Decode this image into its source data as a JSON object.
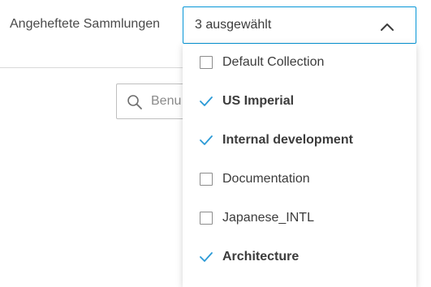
{
  "filter": {
    "label": "Angeheftete Sammlungen",
    "selected_text": "3 ausgewählt"
  },
  "search": {
    "placeholder": "Benu"
  },
  "options": [
    {
      "label": "Default Collection",
      "selected": false
    },
    {
      "label": "US Imperial",
      "selected": true
    },
    {
      "label": "Internal development",
      "selected": true
    },
    {
      "label": "Documentation",
      "selected": false
    },
    {
      "label": "Japanese_INTL",
      "selected": false
    },
    {
      "label": "Architecture",
      "selected": true
    }
  ],
  "colors": {
    "accent": "#0696d7",
    "checkmark": "#2b9ad6",
    "text": "#3c3c3c"
  },
  "icons": {
    "chevron": "chevron-up-icon",
    "search": "search-icon",
    "checked": "checkmark-icon",
    "unchecked": "checkbox-icon"
  }
}
